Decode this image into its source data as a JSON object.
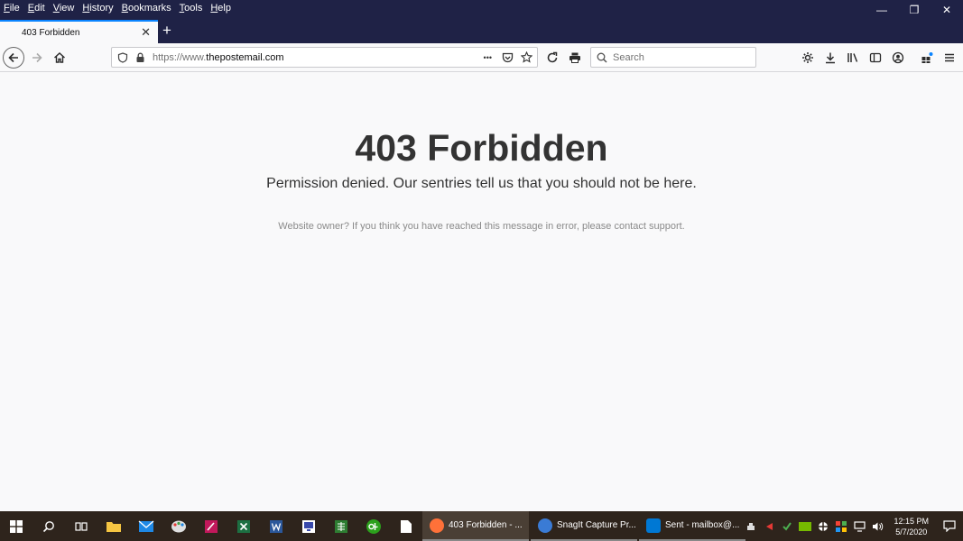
{
  "menu": [
    "File",
    "Edit",
    "View",
    "History",
    "Bookmarks",
    "Tools",
    "Help"
  ],
  "window_controls": {
    "minimize": "—",
    "restore": "❐",
    "close": "✕"
  },
  "tab": {
    "title": "403 Forbidden",
    "close": "✕",
    "new_tab": "+"
  },
  "url": {
    "protocol": "https://www.",
    "host": "thepostemail.com",
    "more": "•••"
  },
  "search": {
    "placeholder": "Search"
  },
  "content": {
    "heading": "403 Forbidden",
    "subheading": "Permission denied. Our sentries tell us that you should not be here.",
    "note": "Website owner? If you think you have reached this message in error, please contact support."
  },
  "taskbar": {
    "apps": [
      {
        "label": "403 Forbidden - ...",
        "color": "#ff7139",
        "active": true
      },
      {
        "label": "SnagIt Capture Pr...",
        "color": "#3a7bd5",
        "active": false
      },
      {
        "label": "Sent - mailbox@...",
        "color": "#0078d4",
        "active": false
      }
    ],
    "time": "12:15 PM",
    "date": "5/7/2020"
  },
  "colors": {
    "accent": "#0a84ff",
    "chrome": "#1f2246",
    "taskbar": "#2e241c"
  }
}
